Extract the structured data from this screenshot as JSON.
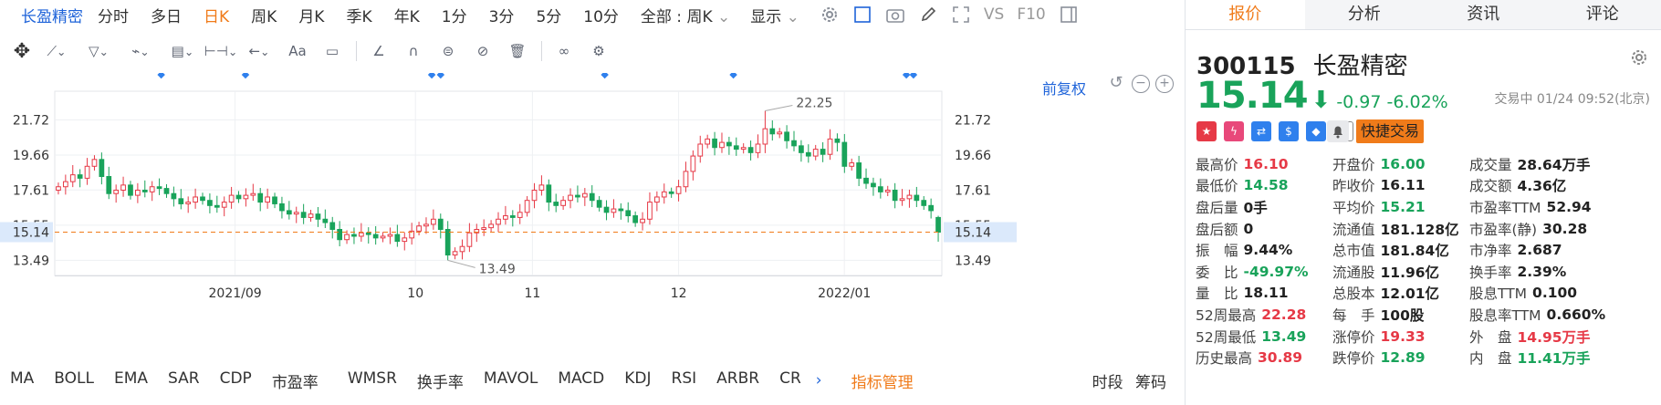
{
  "toolbar": {
    "stock_name": "长盈精密",
    "periods": [
      "分时",
      "多日",
      "日K",
      "周K",
      "月K",
      "季K",
      "年K",
      "1分",
      "3分",
      "5分",
      "10分"
    ],
    "active_period": "日K",
    "scope_select": "全部 : 周K",
    "display_select": "显示",
    "vs_label": "VS",
    "f10_label": "F10"
  },
  "chart": {
    "adjust_label": "前复权",
    "y_ticks": [
      "21.72",
      "19.66",
      "17.61",
      "15.55",
      "13.49"
    ],
    "x_ticks": [
      {
        "label": "2021/09",
        "date": "2021-09-01"
      },
      {
        "label": "10",
        "date": "2021-10-08"
      },
      {
        "label": "11",
        "date": "2021-11-01"
      },
      {
        "label": "12",
        "date": "2021-12-01"
      },
      {
        "label": "2022/01",
        "date": "2022-01-04"
      }
    ],
    "current_price_label": "15.14",
    "high_annotation": "22.25",
    "low_annotation": "13.49",
    "up_color": "#e63946",
    "down_color": "#19a35a"
  },
  "chart_data": {
    "type": "candlestick",
    "title": "",
    "ylim": [
      12.6,
      23.4
    ],
    "current_price": 15.14,
    "closes": [
      17.8,
      18.1,
      18.5,
      18.3,
      19.0,
      19.4,
      18.4,
      17.4,
      17.6,
      17.9,
      17.3,
      17.6,
      17.5,
      17.8,
      17.7,
      17.4,
      17.1,
      16.8,
      16.9,
      17.2,
      17.0,
      16.7,
      16.6,
      16.9,
      17.3,
      17.1,
      17.3,
      17.4,
      16.9,
      17.2,
      16.8,
      16.4,
      16.2,
      16.3,
      16.0,
      16.2,
      15.9,
      15.7,
      15.3,
      14.7,
      15.0,
      14.9,
      15.1,
      15.0,
      14.8,
      14.9,
      15.0,
      14.6,
      14.8,
      15.2,
      15.5,
      15.6,
      15.9,
      15.3,
      13.8,
      14.0,
      14.3,
      15.1,
      15.3,
      15.4,
      15.6,
      15.9,
      16.1,
      16.0,
      16.3,
      17.0,
      17.6,
      17.9,
      16.9,
      16.7,
      17.0,
      17.3,
      17.2,
      17.4,
      17.0,
      16.6,
      16.3,
      16.5,
      16.4,
      16.1,
      15.7,
      15.9,
      16.9,
      17.2,
      17.5,
      17.4,
      17.8,
      18.7,
      19.6,
      20.3,
      20.6,
      20.1,
      20.4,
      20.2,
      20.0,
      20.1,
      19.8,
      20.3,
      21.2,
      20.9,
      21.0,
      20.5,
      20.2,
      19.8,
      19.6,
      20.0,
      19.7,
      20.6,
      20.4,
      19.0,
      19.2,
      18.3,
      18.0,
      17.8,
      17.5,
      17.6,
      17.0,
      17.1,
      17.3,
      17.0,
      16.7,
      16.4,
      15.14
    ],
    "series": [
      {
        "name": "",
        "values": []
      }
    ]
  },
  "indicators": [
    "MA",
    "BOLL",
    "EMA",
    "SAR",
    "CDP",
    "市盈率",
    "WMSR",
    "换手率",
    "MAVOL",
    "MACD",
    "KDJ",
    "RSI",
    "ARBR",
    "CR"
  ],
  "indicator_manage": "指标管理",
  "bottom_tabs": [
    "时段",
    "筹码"
  ],
  "panel": {
    "tabs": [
      "报价",
      "分析",
      "资讯",
      "评论"
    ],
    "code": "300115",
    "name": "长盈精密",
    "price": "15.14",
    "change": "-0.97",
    "change_pct": "-6.02%",
    "trade_status": "交易中 01/24 09:52(北京)",
    "watch_label": "自选",
    "quick_trade": "快捷交易",
    "stats": [
      [
        {
          "l": "最高价",
          "v": "16.10",
          "c": "red"
        },
        {
          "l": "开盘价",
          "v": "16.00",
          "c": "green"
        },
        {
          "l": "成交量",
          "v": "28.64万手",
          "c": ""
        }
      ],
      [
        {
          "l": "最低价",
          "v": "14.58",
          "c": "green"
        },
        {
          "l": "昨收价",
          "v": "16.11",
          "c": ""
        },
        {
          "l": "成交额",
          "v": "4.36亿",
          "c": ""
        }
      ],
      [
        {
          "l": "盘后量",
          "v": "0手",
          "c": ""
        },
        {
          "l": "平均价",
          "v": "15.21",
          "c": "green"
        },
        {
          "l": "市盈率TTM",
          "v": "52.94",
          "c": ""
        }
      ],
      [
        {
          "l": "盘后额",
          "v": "0",
          "c": ""
        },
        {
          "l": "流通值",
          "v": "181.128亿",
          "c": ""
        },
        {
          "l": "市盈率(静)",
          "v": "30.28",
          "c": ""
        }
      ],
      [
        {
          "l": "振　幅",
          "v": "9.44%",
          "c": ""
        },
        {
          "l": "总市值",
          "v": "181.84亿",
          "c": ""
        },
        {
          "l": "市净率",
          "v": "2.687",
          "c": ""
        }
      ],
      [
        {
          "l": "委　比",
          "v": "-49.97%",
          "c": "green"
        },
        {
          "l": "流通股",
          "v": "11.96亿",
          "c": ""
        },
        {
          "l": "换手率",
          "v": "2.39%",
          "c": ""
        }
      ],
      [
        {
          "l": "量　比",
          "v": "18.11",
          "c": ""
        },
        {
          "l": "总股本",
          "v": "12.01亿",
          "c": ""
        },
        {
          "l": "股息TTM",
          "v": "0.100",
          "c": ""
        }
      ],
      [
        {
          "l": "52周最高",
          "v": "22.28",
          "c": "red"
        },
        {
          "l": "每　手",
          "v": "100股",
          "c": ""
        },
        {
          "l": "股息率TTM",
          "v": "0.660%",
          "c": ""
        }
      ],
      [
        {
          "l": "52周最低",
          "v": "13.49",
          "c": "green"
        },
        {
          "l": "涨停价",
          "v": "19.33",
          "c": "red"
        },
        {
          "l": "外　盘",
          "v": "14.95万手",
          "c": "red"
        }
      ],
      [
        {
          "l": "历史最高",
          "v": "30.89",
          "c": "red"
        },
        {
          "l": "跌停价",
          "v": "12.89",
          "c": "green"
        },
        {
          "l": "内　盘",
          "v": "11.41万手",
          "c": "green"
        }
      ]
    ]
  }
}
